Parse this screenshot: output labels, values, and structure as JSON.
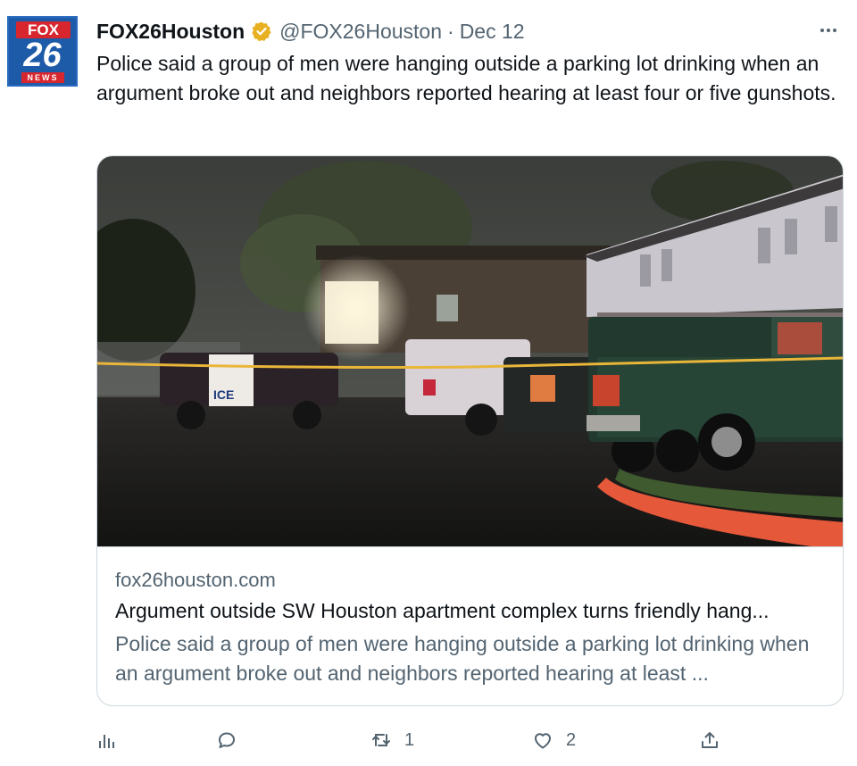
{
  "account": {
    "name": "FOX26Houston",
    "handle": "@FOX26Houston",
    "separator": "·",
    "date": "Dec 12",
    "avatar": {
      "top": "FOX",
      "number": "26",
      "bottom": "NEWS"
    },
    "verified_color": "#e8b122"
  },
  "tweet": {
    "text": "Police said a group of men were hanging outside a parking lot drinking when an argument broke out and neighbors reported hearing at least four or five gunshots."
  },
  "card": {
    "image_alt": "Pickup trucks and police car parked behind yellow tape outside an apartment complex at night",
    "police_car_text": "ICE",
    "domain": "fox26houston.com",
    "title": "Argument outside SW Houston apartment complex turns friendly hang...",
    "description": "Police said a group of men were hanging outside a parking lot drinking when an argument broke out and neighbors reported hearing at least ..."
  },
  "actions": {
    "views_icon": "bar-chart-icon",
    "reply_icon": "reply-bubble-icon",
    "retweet_icon": "retweet-icon",
    "retweet_count": "1",
    "like_icon": "heart-icon",
    "like_count": "2",
    "share_icon": "share-upload-icon"
  },
  "colors": {
    "text": "#0f1419",
    "secondary": "#536471",
    "border": "#cfd9de",
    "brand_blue": "#1d5aa8",
    "brand_red": "#d7262e"
  }
}
